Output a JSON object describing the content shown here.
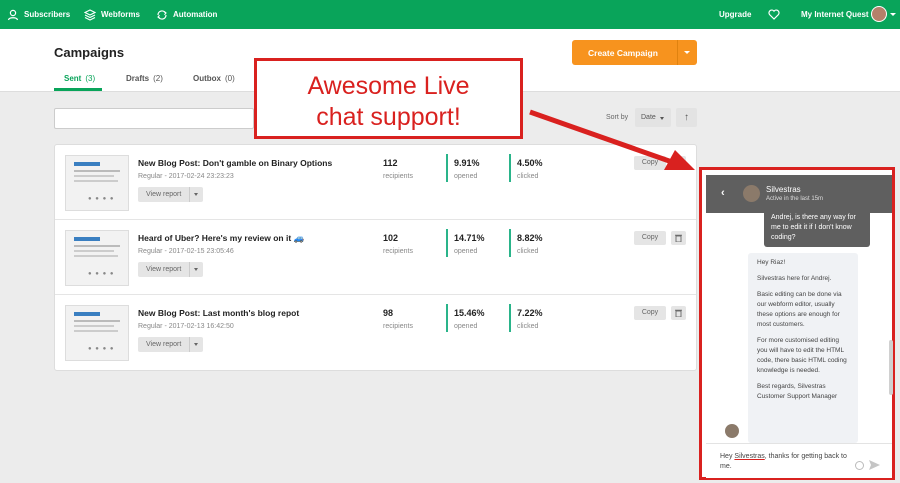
{
  "nav": {
    "subscribers": "Subscribers",
    "webforms": "Webforms",
    "automation": "Automation",
    "upgrade": "Upgrade",
    "account": "My Internet Quest"
  },
  "page": {
    "title": "Campaigns",
    "create_button": "Create Campaign",
    "tabs": [
      {
        "label": "Sent",
        "count": "(3)"
      },
      {
        "label": "Drafts",
        "count": "(2)"
      },
      {
        "label": "Outbox",
        "count": "(0)"
      }
    ],
    "sort_label": "Sort by",
    "sort_value": "Date",
    "sort_direction": "↑"
  },
  "campaigns": [
    {
      "name": "New Blog Post: Don't gamble on Binary Options",
      "meta": "Regular - 2017-02-24 23:23:23",
      "view_label": "View report",
      "recipients": "112",
      "recipients_label": "recipients",
      "opened": "9.91%",
      "opened_label": "opened",
      "clicked": "4.50%",
      "clicked_label": "clicked",
      "copy_label": "Copy"
    },
    {
      "name": "Heard of Uber? Here's my review on it 🚙",
      "meta": "Regular - 2017-02-15 23:05:46",
      "view_label": "View report",
      "recipients": "102",
      "recipients_label": "recipients",
      "opened": "14.71%",
      "opened_label": "opened",
      "clicked": "8.82%",
      "clicked_label": "clicked",
      "copy_label": "Copy"
    },
    {
      "name": "New Blog Post: Last month's blog repot",
      "meta": "Regular - 2017-02-13 16:42:50",
      "view_label": "View report",
      "recipients": "98",
      "recipients_label": "recipients",
      "opened": "15.46%",
      "opened_label": "opened",
      "clicked": "7.22%",
      "clicked_label": "clicked",
      "copy_label": "Copy"
    }
  ],
  "annotation": {
    "line1": "Awesome Live",
    "line2": "chat support!"
  },
  "chat": {
    "agent_name": "Silvestras",
    "agent_status": "Active in the last 15m",
    "user_message": "Andrej, is there any way for me to edit it if I don't know coding?",
    "agent_paragraphs": [
      "Hey Riaz!",
      "Silvestras here for Andrej.",
      "Basic editing can be done via our webform editor, usually these options are enough for most customers.",
      "For more customised editing you will have to edit the HTML code, there basic HTML coding knowledge is needed.",
      "Best regards, Silvestras Customer Support Manager"
    ],
    "input_prefix": "Hey ",
    "input_name": "Silvestras",
    "input_suffix": ", thanks for getting back to me."
  },
  "colors": {
    "brand_green": "#09a45a",
    "create_orange": "#f7931e",
    "annotation_red": "#d9211f",
    "stat_bar": "#2ab48a"
  },
  "icons": [
    "subscribers-icon",
    "webforms-icon",
    "automation-icon",
    "heart-icon",
    "trash-icon",
    "back-icon",
    "emoji-icon",
    "send-icon"
  ]
}
